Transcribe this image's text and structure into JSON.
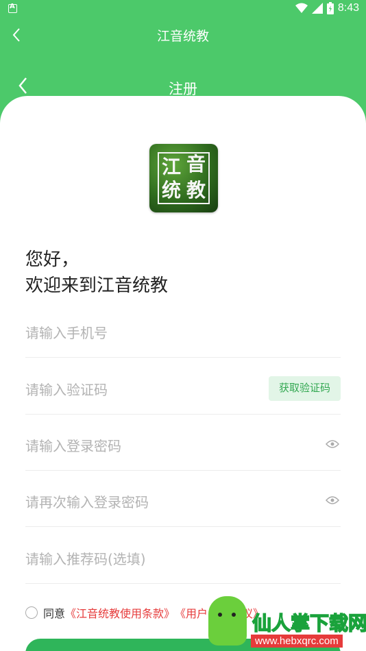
{
  "status_bar": {
    "time": "8:43"
  },
  "top_bar": {
    "title": "江音统教"
  },
  "inner_bar": {
    "title": "注册"
  },
  "logo": {
    "chars": [
      "江",
      "音",
      "统",
      "教"
    ]
  },
  "greeting": {
    "line1": "您好，",
    "line2": "欢迎来到江音统教"
  },
  "form": {
    "phone_placeholder": "请输入手机号",
    "code_placeholder": "请输入验证码",
    "get_code_label": "获取验证码",
    "password_placeholder": "请输入登录密码",
    "password_confirm_placeholder": "请再次输入登录密码",
    "referral_placeholder": "请输入推荐码(选填)"
  },
  "agreement": {
    "prefix": "同意",
    "terms_link": "《江音统教使用条款》",
    "user_link": "《用户",
    "user_link_end": "协议》"
  },
  "watermark": {
    "text": "仙人掌下载网",
    "url": "www.hebxqrc.com"
  },
  "colors": {
    "brand_green": "#4cc96a",
    "button_green": "#2fb55a",
    "link_red": "#e63b3b"
  }
}
